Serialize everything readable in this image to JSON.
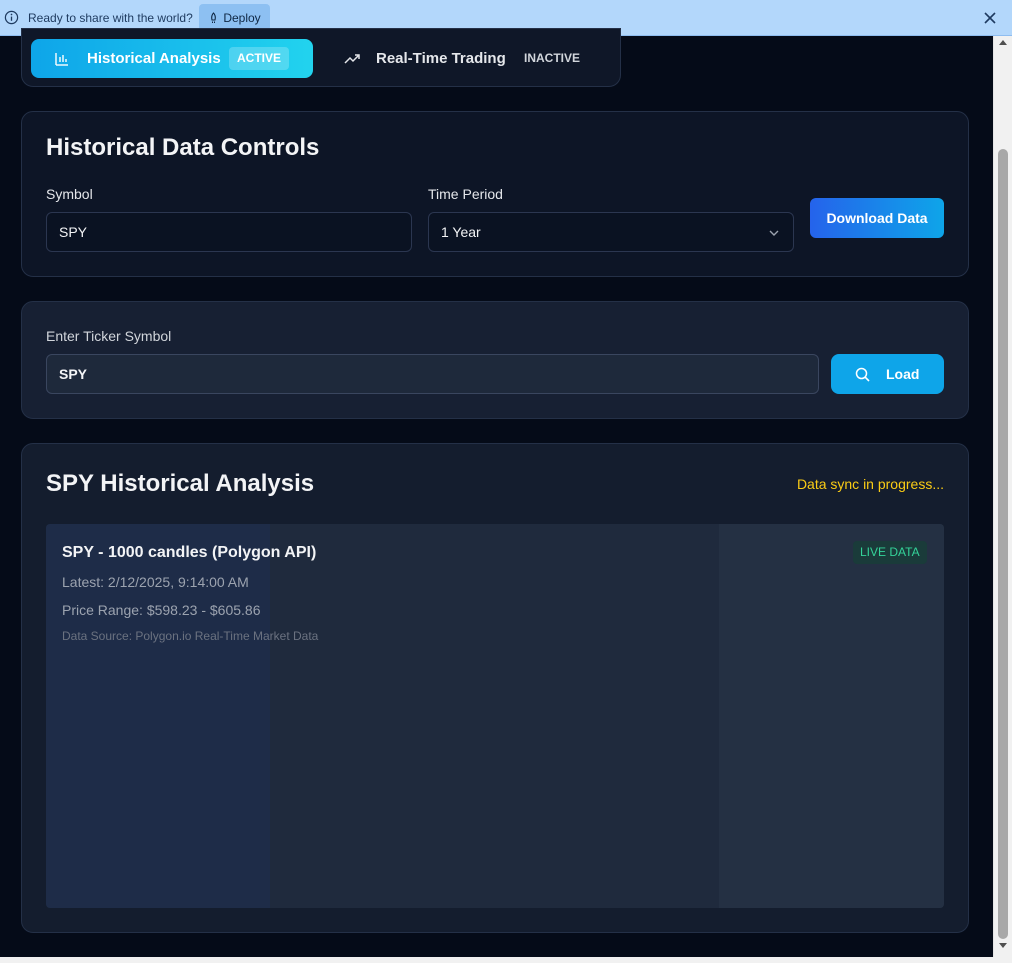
{
  "banner": {
    "message": "Ready to share with the world?",
    "deploy_label": "Deploy"
  },
  "mode_tabs": [
    {
      "label": "Historical Analysis",
      "status": "ACTIVE",
      "icon": "bar-chart-icon"
    },
    {
      "label": "Real-Time Trading",
      "status": "INACTIVE",
      "icon": "trending-up-icon"
    }
  ],
  "controls": {
    "title": "Historical Data Controls",
    "symbol_label": "Symbol",
    "symbol_value": "SPY",
    "period_label": "Time Period",
    "period_value": "1 Year",
    "download_label": "Download Data"
  },
  "ticker": {
    "label": "Enter Ticker Symbol",
    "value": "SPY",
    "load_label": "Load"
  },
  "analysis": {
    "title": "SPY Historical Analysis",
    "sync_status": "Data sync in progress...",
    "chart_title": "SPY - 1000 candles (Polygon API)",
    "latest": "Latest: 2/12/2025, 9:14:00 AM",
    "price_range": "Price Range: $598.23 - $605.86",
    "source": "Data Source: Polygon.io Real-Time Market Data",
    "live_badge": "LIVE DATA"
  },
  "colors": {
    "accent": "#0ea5e9",
    "sync": "#facc15",
    "live": "#34d399"
  }
}
